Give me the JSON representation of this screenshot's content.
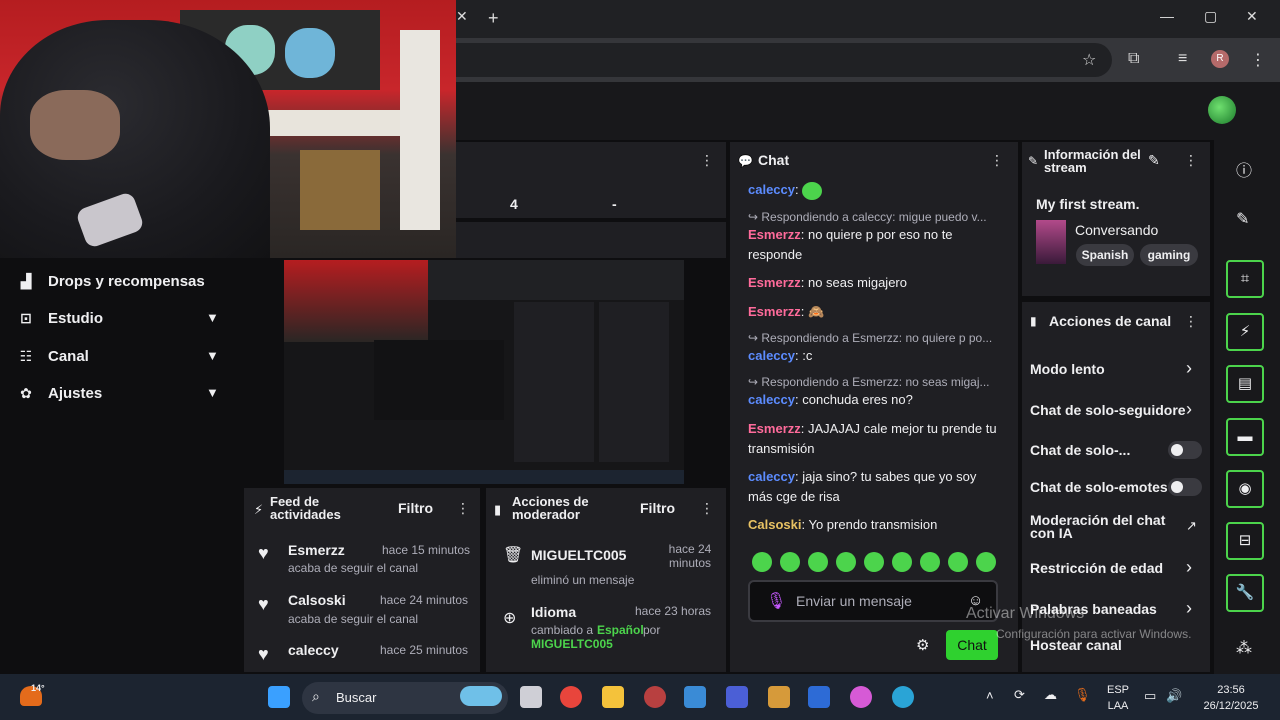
{
  "browser": {
    "close_tab": "✕",
    "new_tab": "+",
    "minimize": "—",
    "maximize": "▢",
    "close_window": "✕",
    "profile": "R"
  },
  "nav": {
    "items": [
      {
        "label": "Drops y recompensas",
        "icon": "drops-icon"
      },
      {
        "label": "Estudio",
        "icon": "studio-icon"
      },
      {
        "label": "Canal",
        "icon": "channel-icon"
      },
      {
        "label": "Ajustes",
        "icon": "settings-icon"
      }
    ]
  },
  "stats": {
    "value_a": "4",
    "value_b": "-"
  },
  "feed": {
    "title": "Feed de actividades",
    "filter": "Filtro",
    "items": [
      {
        "user": "Esmerzz",
        "time": "hace 15 minutos",
        "desc": "acaba de seguir el canal"
      },
      {
        "user": "Calsoski",
        "time": "hace 24 minutos",
        "desc": "acaba de seguir el canal"
      },
      {
        "user": "caleccy",
        "time": "hace 25 minutos",
        "desc": ""
      }
    ]
  },
  "mod": {
    "title": "Acciones de moderador",
    "filter": "Filtro",
    "items": [
      {
        "user": "MIGUELTC005",
        "time": "hace 24 minutos",
        "desc": "eliminó un mensaje"
      },
      {
        "user": "Idioma",
        "time": "hace 23 horas",
        "desc_prefix": "cambiado a",
        "desc_highlight": "Español",
        "desc_mid": "por",
        "desc_by": "MIGUELTC005"
      }
    ]
  },
  "chat": {
    "title": "Chat",
    "messages": [
      {
        "user": "caleccy",
        "text": ""
      },
      {
        "reply": "Respondiendo a caleccy: migue puedo v..."
      },
      {
        "user": "Esmerzz",
        "text": "no quiere p por eso no te responde"
      },
      {
        "user": "Esmerzz",
        "text": "no seas migajero"
      },
      {
        "user": "Esmerzz",
        "text": "🙈"
      },
      {
        "reply": "Respondiendo a Esmerzz: no quiere p po..."
      },
      {
        "user": "caleccy",
        "text": ":c"
      },
      {
        "reply": "Respondiendo a Esmerzz: no seas migaj..."
      },
      {
        "user": "caleccy",
        "text": "conchuda eres no?"
      },
      {
        "user": "Esmerzz",
        "text": "JAJAJAJ cale mejor tu prende tu transmisión"
      },
      {
        "user": "caleccy",
        "text": "jaja sino? tu sabes que yo soy más cge de risa"
      },
      {
        "user": "Calsoski",
        "text": "Yo prendo transmision"
      }
    ],
    "placeholder": "Enviar un mensaje",
    "send": "Chat"
  },
  "stream_info": {
    "title": "Información del stream",
    "stream_title": "My first stream.",
    "category": "Conversando",
    "tags": [
      "Spanish",
      "gaming"
    ]
  },
  "channel_actions": {
    "title": "Acciones de canal",
    "items": [
      {
        "label": "Modo lento",
        "control": "chevron"
      },
      {
        "label": "Chat de solo-seguidore",
        "control": "chevron"
      },
      {
        "label": "Chat de solo-...",
        "control": "toggle"
      },
      {
        "label": "Chat de solo-emotes",
        "control": "toggle"
      },
      {
        "label": "Moderación del chat con IA",
        "control": "external"
      },
      {
        "label": "Restricción de edad",
        "control": "chevron"
      },
      {
        "label": "Palabras baneadas",
        "control": "chevron"
      },
      {
        "label": "Hostear canal",
        "control": "none"
      }
    ]
  },
  "watermark": {
    "line1": "Activar Windows",
    "line2": "Configuración para activar Windows."
  },
  "taskbar": {
    "search": "Buscar",
    "temp": "14°",
    "lang1": "ESP",
    "lang2": "LAA",
    "time": "23:56",
    "date": "26/12/2025"
  },
  "colors": {
    "accent": "#2fd12f",
    "user_caleccy": "#5c8cff",
    "user_esmerzz": "#ff6b9b",
    "user_calsoski": "#e8c263"
  }
}
